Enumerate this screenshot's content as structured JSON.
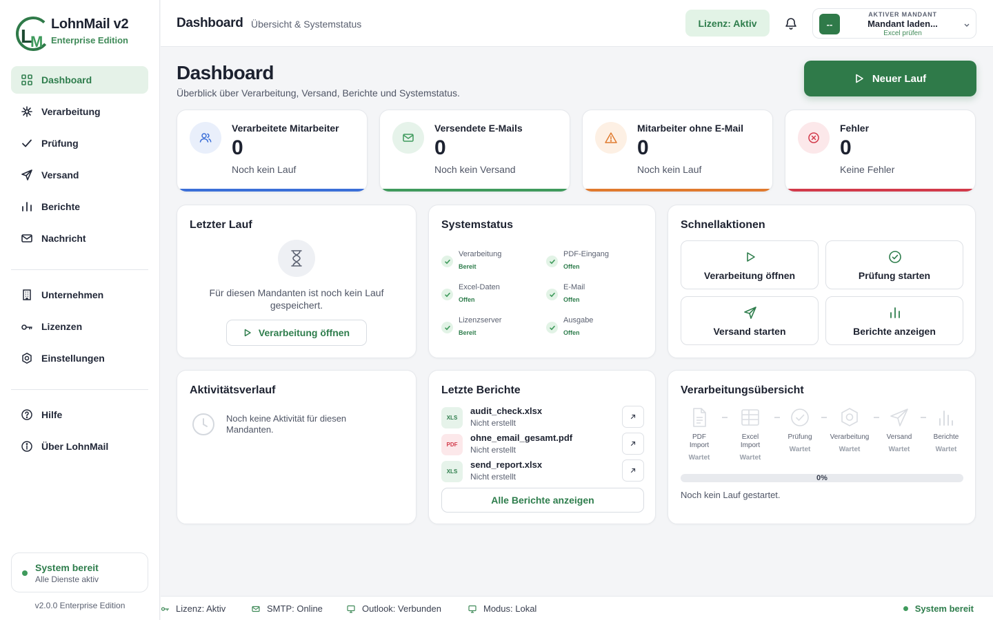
{
  "app": {
    "name": "LohnMail v2",
    "edition": "Enterprise Edition",
    "version": "v2.0.0 Enterprise Edition"
  },
  "sidebar": {
    "primary": [
      {
        "label": "Dashboard",
        "icon": "grid-icon",
        "active": true
      },
      {
        "label": "Verarbeitung",
        "icon": "sparkle-icon"
      },
      {
        "label": "Prüfung",
        "icon": "check-icon"
      },
      {
        "label": "Versand",
        "icon": "send-icon"
      },
      {
        "label": "Berichte",
        "icon": "bar-chart-icon"
      },
      {
        "label": "Nachricht",
        "icon": "mail-icon"
      }
    ],
    "secondary": [
      {
        "label": "Unternehmen",
        "icon": "building-icon"
      },
      {
        "label": "Lizenzen",
        "icon": "key-icon"
      },
      {
        "label": "Einstellungen",
        "icon": "settings-icon"
      }
    ],
    "tertiary": [
      {
        "label": "Hilfe",
        "icon": "help-icon"
      },
      {
        "label": "Über LohnMail",
        "icon": "info-icon"
      }
    ],
    "system": {
      "title": "System bereit",
      "subtitle": "Alle Dienste aktiv"
    }
  },
  "topbar": {
    "title": "Dashboard",
    "subtitle": "Übersicht & Systemstatus",
    "license": "Lizenz: Aktiv",
    "tenant": {
      "label": "AKTIVER MANDANT",
      "name": "Mandant laden...",
      "sub": "Excel prüfen",
      "avatar": "--"
    }
  },
  "page": {
    "title": "Dashboard",
    "subtitle": "Überblick über Verarbeitung, Versand, Berichte und Systemstatus.",
    "new_run": "Neuer Lauf"
  },
  "stats": [
    {
      "label": "Verarbeitete Mitarbeiter",
      "value": "0",
      "sub": "Noch kein Lauf",
      "color": "#3b6fd8"
    },
    {
      "label": "Versendete E-Mails",
      "value": "0",
      "sub": "Noch kein Versand",
      "color": "#3f9a5c"
    },
    {
      "label": "Mitarbeiter ohne E-Mail",
      "value": "0",
      "sub": "Noch kein Lauf",
      "color": "#e07a2e"
    },
    {
      "label": "Fehler",
      "value": "0",
      "sub": "Keine Fehler",
      "color": "#d23a4a"
    }
  ],
  "last_run": {
    "title": "Letzter Lauf",
    "message": "Für diesen Mandanten ist noch kein Lauf gespeichert.",
    "button": "Verarbeitung öffnen"
  },
  "system_status": {
    "title": "Systemstatus",
    "items": [
      {
        "name": "Verarbeitung",
        "state": "Bereit"
      },
      {
        "name": "PDF-Eingang",
        "state": "Offen"
      },
      {
        "name": "Excel-Daten",
        "state": "Offen"
      },
      {
        "name": "E-Mail",
        "state": "Offen"
      },
      {
        "name": "Lizenzserver",
        "state": "Bereit"
      },
      {
        "name": "Ausgabe",
        "state": "Offen"
      }
    ]
  },
  "quick_actions": {
    "title": "Schnellaktionen",
    "items": [
      {
        "label": "Verarbeitung öffnen",
        "icon": "play-icon"
      },
      {
        "label": "Prüfung starten",
        "icon": "check-circle-icon"
      },
      {
        "label": "Versand starten",
        "icon": "send-icon"
      },
      {
        "label": "Berichte anzeigen",
        "icon": "bar-chart-icon"
      }
    ]
  },
  "activity": {
    "title": "Aktivitätsverlauf",
    "empty": "Noch keine Aktivität für diesen Mandanten."
  },
  "reports": {
    "title": "Letzte Berichte",
    "items": [
      {
        "badge": "XLS",
        "name": "audit_check.xlsx",
        "state": "Nicht erstellt"
      },
      {
        "badge": "PDF",
        "name": "ohne_email_gesamt.pdf",
        "state": "Nicht erstellt"
      },
      {
        "badge": "XLS",
        "name": "send_report.xlsx",
        "state": "Nicht erstellt"
      }
    ],
    "all_button": "Alle Berichte anzeigen"
  },
  "overview": {
    "title": "Verarbeitungsübersicht",
    "steps": [
      {
        "line1": "PDF",
        "line2": "Import",
        "state": "Wartet"
      },
      {
        "line1": "Excel",
        "line2": "Import",
        "state": "Wartet"
      },
      {
        "line1": "Prüfung",
        "line2": "",
        "state": "Wartet"
      },
      {
        "line1": "Verarbeitung",
        "line2": "",
        "state": "Wartet"
      },
      {
        "line1": "Versand",
        "line2": "",
        "state": "Wartet"
      },
      {
        "line1": "Berichte",
        "line2": "",
        "state": "Wartet"
      }
    ],
    "progress": 0,
    "progress_label": "0%",
    "note": "Noch kein Lauf gestartet."
  },
  "statusbar": {
    "license": "Lizenz: Aktiv",
    "smtp": "SMTP: Online",
    "outlook": "Outlook: Verbunden",
    "mode": "Modus: Lokal",
    "ready": "System bereit"
  }
}
